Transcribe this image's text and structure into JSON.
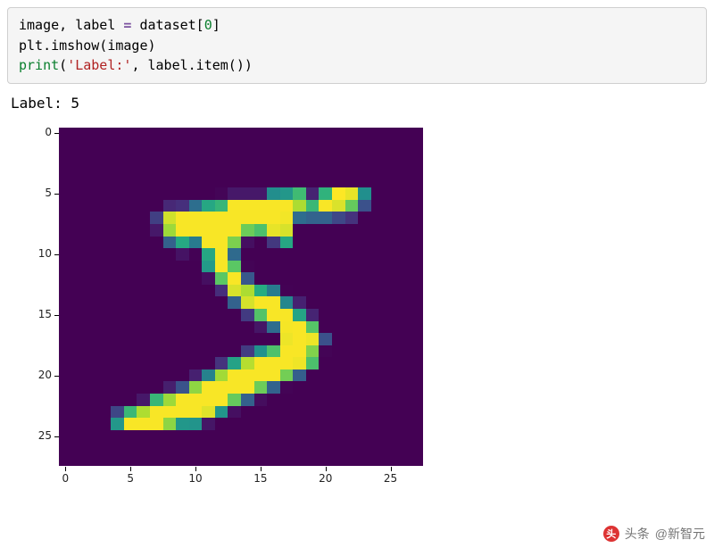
{
  "code": {
    "line1": {
      "a": "image, label ",
      "op": "=",
      "b": " dataset[",
      "num": "0",
      "c": "]"
    },
    "line2": {
      "a": "plt.imshow(image)"
    },
    "line3": {
      "fn": "print",
      "a": "(",
      "str": "'Label:'",
      "b": ", label.item())"
    }
  },
  "output_text": "Label: 5",
  "chart_data": {
    "type": "heatmap",
    "title": "",
    "xlabel": "",
    "ylabel": "",
    "x_ticks": [
      0,
      5,
      10,
      15,
      20,
      25
    ],
    "y_ticks": [
      0,
      5,
      10,
      15,
      20,
      25
    ],
    "xlim": [
      -0.5,
      27.5
    ],
    "ylim": [
      27.5,
      -0.5
    ],
    "colormap": "viridis",
    "values_meaning": "28x28 MNIST digit '5', grayscale 0-255",
    "values": [
      [
        0,
        0,
        0,
        0,
        0,
        0,
        0,
        0,
        0,
        0,
        0,
        0,
        0,
        0,
        0,
        0,
        0,
        0,
        0,
        0,
        0,
        0,
        0,
        0,
        0,
        0,
        0,
        0
      ],
      [
        0,
        0,
        0,
        0,
        0,
        0,
        0,
        0,
        0,
        0,
        0,
        0,
        0,
        0,
        0,
        0,
        0,
        0,
        0,
        0,
        0,
        0,
        0,
        0,
        0,
        0,
        0,
        0
      ],
      [
        0,
        0,
        0,
        0,
        0,
        0,
        0,
        0,
        0,
        0,
        0,
        0,
        0,
        0,
        0,
        0,
        0,
        0,
        0,
        0,
        0,
        0,
        0,
        0,
        0,
        0,
        0,
        0
      ],
      [
        0,
        0,
        0,
        0,
        0,
        0,
        0,
        0,
        0,
        0,
        0,
        0,
        0,
        0,
        0,
        0,
        0,
        0,
        0,
        0,
        0,
        0,
        0,
        0,
        0,
        0,
        0,
        0
      ],
      [
        0,
        0,
        0,
        0,
        0,
        0,
        0,
        0,
        0,
        0,
        0,
        0,
        0,
        0,
        0,
        0,
        0,
        0,
        0,
        0,
        0,
        0,
        0,
        0,
        0,
        0,
        0,
        0
      ],
      [
        0,
        0,
        0,
        0,
        0,
        0,
        0,
        0,
        0,
        0,
        0,
        0,
        3,
        18,
        18,
        18,
        126,
        136,
        175,
        26,
        166,
        255,
        247,
        127,
        0,
        0,
        0,
        0
      ],
      [
        0,
        0,
        0,
        0,
        0,
        0,
        0,
        0,
        30,
        36,
        94,
        154,
        170,
        253,
        253,
        253,
        253,
        253,
        225,
        172,
        253,
        242,
        195,
        64,
        0,
        0,
        0,
        0
      ],
      [
        0,
        0,
        0,
        0,
        0,
        0,
        0,
        49,
        238,
        253,
        253,
        253,
        253,
        253,
        253,
        253,
        253,
        251,
        93,
        82,
        82,
        56,
        39,
        0,
        0,
        0,
        0,
        0
      ],
      [
        0,
        0,
        0,
        0,
        0,
        0,
        0,
        18,
        219,
        253,
        253,
        253,
        253,
        253,
        198,
        182,
        247,
        241,
        0,
        0,
        0,
        0,
        0,
        0,
        0,
        0,
        0,
        0
      ],
      [
        0,
        0,
        0,
        0,
        0,
        0,
        0,
        0,
        80,
        156,
        107,
        253,
        253,
        205,
        11,
        0,
        43,
        154,
        0,
        0,
        0,
        0,
        0,
        0,
        0,
        0,
        0,
        0
      ],
      [
        0,
        0,
        0,
        0,
        0,
        0,
        0,
        0,
        0,
        14,
        1,
        154,
        253,
        90,
        0,
        0,
        0,
        0,
        0,
        0,
        0,
        0,
        0,
        0,
        0,
        0,
        0,
        0
      ],
      [
        0,
        0,
        0,
        0,
        0,
        0,
        0,
        0,
        0,
        0,
        0,
        139,
        253,
        190,
        2,
        0,
        0,
        0,
        0,
        0,
        0,
        0,
        0,
        0,
        0,
        0,
        0,
        0
      ],
      [
        0,
        0,
        0,
        0,
        0,
        0,
        0,
        0,
        0,
        0,
        0,
        11,
        190,
        253,
        70,
        0,
        0,
        0,
        0,
        0,
        0,
        0,
        0,
        0,
        0,
        0,
        0,
        0
      ],
      [
        0,
        0,
        0,
        0,
        0,
        0,
        0,
        0,
        0,
        0,
        0,
        0,
        35,
        241,
        225,
        160,
        108,
        1,
        0,
        0,
        0,
        0,
        0,
        0,
        0,
        0,
        0,
        0
      ],
      [
        0,
        0,
        0,
        0,
        0,
        0,
        0,
        0,
        0,
        0,
        0,
        0,
        0,
        81,
        240,
        253,
        253,
        119,
        25,
        0,
        0,
        0,
        0,
        0,
        0,
        0,
        0,
        0
      ],
      [
        0,
        0,
        0,
        0,
        0,
        0,
        0,
        0,
        0,
        0,
        0,
        0,
        0,
        0,
        45,
        186,
        253,
        253,
        150,
        27,
        0,
        0,
        0,
        0,
        0,
        0,
        0,
        0
      ],
      [
        0,
        0,
        0,
        0,
        0,
        0,
        0,
        0,
        0,
        0,
        0,
        0,
        0,
        0,
        0,
        16,
        93,
        252,
        253,
        187,
        0,
        0,
        0,
        0,
        0,
        0,
        0,
        0
      ],
      [
        0,
        0,
        0,
        0,
        0,
        0,
        0,
        0,
        0,
        0,
        0,
        0,
        0,
        0,
        0,
        0,
        0,
        249,
        253,
        249,
        64,
        0,
        0,
        0,
        0,
        0,
        0,
        0
      ],
      [
        0,
        0,
        0,
        0,
        0,
        0,
        0,
        0,
        0,
        0,
        0,
        0,
        0,
        0,
        46,
        130,
        183,
        253,
        253,
        207,
        2,
        0,
        0,
        0,
        0,
        0,
        0,
        0
      ],
      [
        0,
        0,
        0,
        0,
        0,
        0,
        0,
        0,
        0,
        0,
        0,
        0,
        39,
        148,
        229,
        253,
        253,
        253,
        250,
        182,
        0,
        0,
        0,
        0,
        0,
        0,
        0,
        0
      ],
      [
        0,
        0,
        0,
        0,
        0,
        0,
        0,
        0,
        0,
        0,
        24,
        114,
        221,
        253,
        253,
        253,
        253,
        201,
        78,
        0,
        0,
        0,
        0,
        0,
        0,
        0,
        0,
        0
      ],
      [
        0,
        0,
        0,
        0,
        0,
        0,
        0,
        0,
        23,
        66,
        213,
        253,
        253,
        253,
        253,
        198,
        81,
        2,
        0,
        0,
        0,
        0,
        0,
        0,
        0,
        0,
        0,
        0
      ],
      [
        0,
        0,
        0,
        0,
        0,
        0,
        18,
        171,
        219,
        253,
        253,
        253,
        253,
        195,
        80,
        9,
        0,
        0,
        0,
        0,
        0,
        0,
        0,
        0,
        0,
        0,
        0,
        0
      ],
      [
        0,
        0,
        0,
        0,
        55,
        172,
        226,
        253,
        253,
        253,
        253,
        244,
        133,
        11,
        0,
        0,
        0,
        0,
        0,
        0,
        0,
        0,
        0,
        0,
        0,
        0,
        0,
        0
      ],
      [
        0,
        0,
        0,
        0,
        136,
        253,
        253,
        253,
        212,
        135,
        132,
        16,
        0,
        0,
        0,
        0,
        0,
        0,
        0,
        0,
        0,
        0,
        0,
        0,
        0,
        0,
        0,
        0
      ],
      [
        0,
        0,
        0,
        0,
        0,
        0,
        0,
        0,
        0,
        0,
        0,
        0,
        0,
        0,
        0,
        0,
        0,
        0,
        0,
        0,
        0,
        0,
        0,
        0,
        0,
        0,
        0,
        0
      ],
      [
        0,
        0,
        0,
        0,
        0,
        0,
        0,
        0,
        0,
        0,
        0,
        0,
        0,
        0,
        0,
        0,
        0,
        0,
        0,
        0,
        0,
        0,
        0,
        0,
        0,
        0,
        0,
        0
      ],
      [
        0,
        0,
        0,
        0,
        0,
        0,
        0,
        0,
        0,
        0,
        0,
        0,
        0,
        0,
        0,
        0,
        0,
        0,
        0,
        0,
        0,
        0,
        0,
        0,
        0,
        0,
        0,
        0
      ]
    ]
  },
  "watermark": {
    "prefix": "头条",
    "account": "@新智元"
  }
}
